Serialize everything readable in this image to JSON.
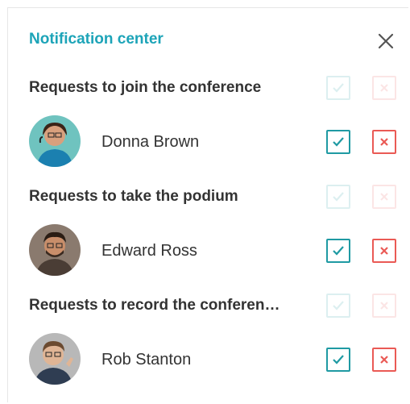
{
  "header": {
    "title": "Notification center",
    "close_icon": "close-icon"
  },
  "sections": [
    {
      "title": "Requests to join the conference",
      "user": {
        "name": "Donna Brown"
      }
    },
    {
      "title": "Requests to take the podium",
      "user": {
        "name": "Edward Ross"
      }
    },
    {
      "title": "Requests to record the conferen…",
      "user": {
        "name": "Rob Stanton"
      }
    }
  ],
  "colors": {
    "accent": "#1da4b8",
    "accept": "#1f9aa3",
    "reject": "#ea5a55",
    "text": "#333333"
  }
}
